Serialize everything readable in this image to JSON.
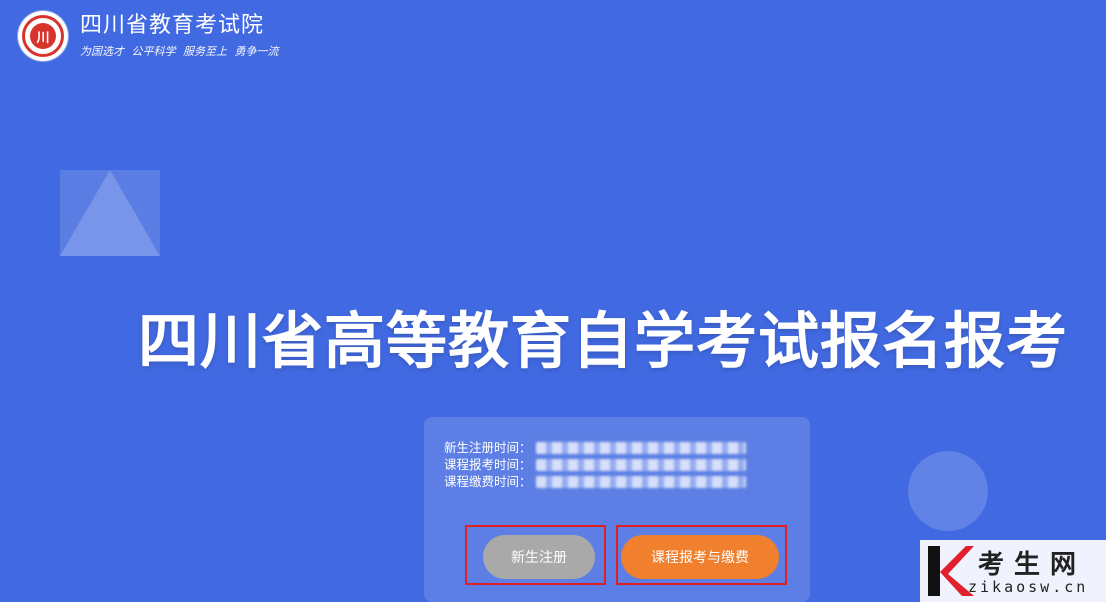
{
  "header": {
    "logo_char": "川",
    "org_name": "四川省教育考试院",
    "slogan": "为国选才 公平科学 服务至上 勇争一流"
  },
  "main_title": "四川省高等教育自学考试报名报考",
  "schedule": {
    "rows": [
      {
        "label": "新生注册时间："
      },
      {
        "label": "课程报考时间："
      },
      {
        "label": "课程缴费时间："
      }
    ]
  },
  "actions": {
    "register_label": "新生注册",
    "exam_label": "课程报考与缴费"
  },
  "watermark": {
    "name": "考生网",
    "url": "zikaosw.cn"
  },
  "colors": {
    "background": "#4169e1",
    "register_button": "#a9a9a9",
    "exam_button": "#f07f2e",
    "highlight_frame": "#e02020",
    "logo_red": "#d6342c"
  }
}
